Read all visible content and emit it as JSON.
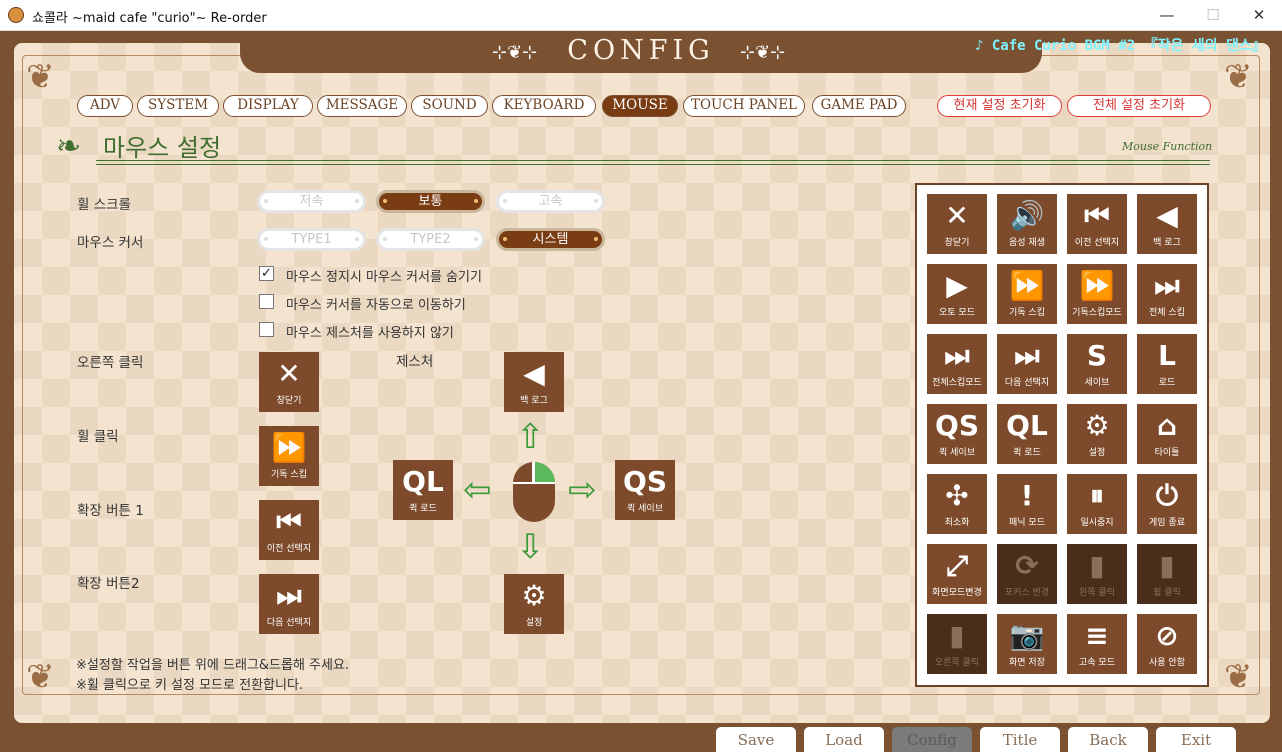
{
  "window": {
    "title": "쇼콜라 ~maid cafe \"curio\"~ Re-order",
    "min": "—",
    "max": "☐",
    "close": "✕"
  },
  "header": {
    "title": "CONFIG",
    "ornament_left": "⊹❦⊹",
    "ornament_right": "⊹❦⊹",
    "bgm": "♪ Cafe Curio BGM #2 『작은 새의 댄스』"
  },
  "tabs": [
    {
      "label": "ADV"
    },
    {
      "label": "SYSTEM"
    },
    {
      "label": "DISPLAY"
    },
    {
      "label": "MESSAGE"
    },
    {
      "label": "SOUND"
    },
    {
      "label": "KEYBOARD"
    },
    {
      "label": "MOUSE",
      "active": true
    },
    {
      "label": "TOUCH PANEL"
    },
    {
      "label": "GAME PAD"
    }
  ],
  "reset": {
    "current": "현재 설정 초기화",
    "all": "전체 설정 초기화"
  },
  "section": {
    "title": "마우스 설정",
    "subtitle": "Mouse Function",
    "icon": "leaf-swirl-icon"
  },
  "wheel_scroll": {
    "label": "휠 스크롤",
    "options": [
      "저속",
      "보통",
      "고속"
    ],
    "selected": "보통"
  },
  "mouse_cursor": {
    "label": "마우스 커서",
    "options": [
      "TYPE1",
      "TYPE2",
      "시스템"
    ],
    "selected": "시스템"
  },
  "checkboxes": [
    {
      "label": "마우스 정지시 마우스 커서를 숨기기",
      "checked": true,
      "mark": "✓"
    },
    {
      "label": "마우스 커서를 자동으로 이동하기",
      "checked": false,
      "mark": ""
    },
    {
      "label": "마우스 제스처를 사용하지 않기",
      "checked": false,
      "mark": ""
    }
  ],
  "assign": {
    "right_click": {
      "label": "오른쪽 클릭",
      "icon": "✕",
      "text": "창닫기"
    },
    "wheel_click": {
      "label": "휠 클릭",
      "icon": "⏩",
      "text": "기독 스킵"
    },
    "ext1": {
      "label": "확장 버튼 1",
      "icon": "⏮",
      "text": "이전 선택지"
    },
    "ext2": {
      "label": "확장 버튼2",
      "icon": "⏭",
      "text": "다음 선택지"
    }
  },
  "gesture": {
    "label": "제스처",
    "up": {
      "icon": "◀",
      "text": "백 로그"
    },
    "left": {
      "icon": "QL",
      "text": "퀵 로드"
    },
    "right": {
      "icon": "QS",
      "text": "퀵 세이브"
    },
    "down": {
      "icon": "⚙",
      "text": "설정"
    },
    "arrows": {
      "up": "⇧",
      "down": "⇩",
      "left": "⇦",
      "right": "⇨"
    }
  },
  "palette": [
    {
      "icon": "✕",
      "text": "창닫기",
      "name": "close-icon"
    },
    {
      "icon": "🔊",
      "text": "음성 재생",
      "name": "speaker-icon"
    },
    {
      "icon": "⏮",
      "text": "이전 선택지",
      "name": "prev-choice-icon"
    },
    {
      "icon": "◀",
      "text": "백 로그",
      "name": "backlog-icon"
    },
    {
      "icon": "▶",
      "text": "오토 모드",
      "name": "auto-icon"
    },
    {
      "icon": "⏩",
      "text": "기독 스킵",
      "name": "skip-read-icon"
    },
    {
      "icon": "⏩",
      "text": "기독스킵모드",
      "name": "skip-mode-icon"
    },
    {
      "icon": "⏭",
      "text": "전체 스킵",
      "name": "skip-all-icon"
    },
    {
      "icon": "⏭",
      "text": "전체스킵모드",
      "name": "skip-all-mode-icon"
    },
    {
      "icon": "⏭",
      "text": "다음 선택지",
      "name": "next-choice-icon"
    },
    {
      "icon": "S",
      "text": "세이브",
      "name": "save-icon"
    },
    {
      "icon": "L",
      "text": "로드",
      "name": "load-icon"
    },
    {
      "icon": "QS",
      "text": "퀵 세이브",
      "name": "quick-save-icon"
    },
    {
      "icon": "QL",
      "text": "퀵 로드",
      "name": "quick-load-icon"
    },
    {
      "icon": "⚙",
      "text": "설정",
      "name": "gear-icon"
    },
    {
      "icon": "⌂",
      "text": "타이틀",
      "name": "home-icon"
    },
    {
      "icon": "✣",
      "text": "최소화",
      "name": "minimize-icon"
    },
    {
      "icon": "!",
      "text": "패닉 모드",
      "name": "panic-icon"
    },
    {
      "icon": "⏸",
      "text": "일시중지",
      "name": "pause-icon"
    },
    {
      "icon": "⏻",
      "text": "게임 종료",
      "name": "power-icon"
    },
    {
      "icon": "⤢",
      "text": "화면모드변경",
      "name": "fullscreen-icon"
    },
    {
      "icon": "⟳",
      "text": "포커스 변경",
      "name": "focus-icon",
      "dark": true
    },
    {
      "icon": "▮",
      "text": "왼쪽 클릭",
      "name": "left-click-icon",
      "dark": true
    },
    {
      "icon": "▮",
      "text": "휠 클릭",
      "name": "wheel-click-icon",
      "dark": true
    },
    {
      "icon": "▮",
      "text": "오른쪽 클릭",
      "name": "right-click-icon",
      "dark": true
    },
    {
      "icon": "📷",
      "text": "화면 저장",
      "name": "camera-icon"
    },
    {
      "icon": "≡",
      "text": "고속 모드",
      "name": "fast-mode-icon"
    },
    {
      "icon": "⊘",
      "text": "사용 안함",
      "name": "disable-icon"
    }
  ],
  "notes": [
    "※설정할 작업을 버튼 위에 드래그&드롭해 주세요.",
    "※휠 클릭으로 키 설정 모드로 전환합니다."
  ],
  "bottom": [
    "Save",
    "Load",
    "Config",
    "Title",
    "Back",
    "Exit"
  ],
  "colors": {
    "accent": "#7a3c12",
    "frame": "#7a5232",
    "green": "#3f6e2f",
    "reset": "#e03b3b"
  }
}
